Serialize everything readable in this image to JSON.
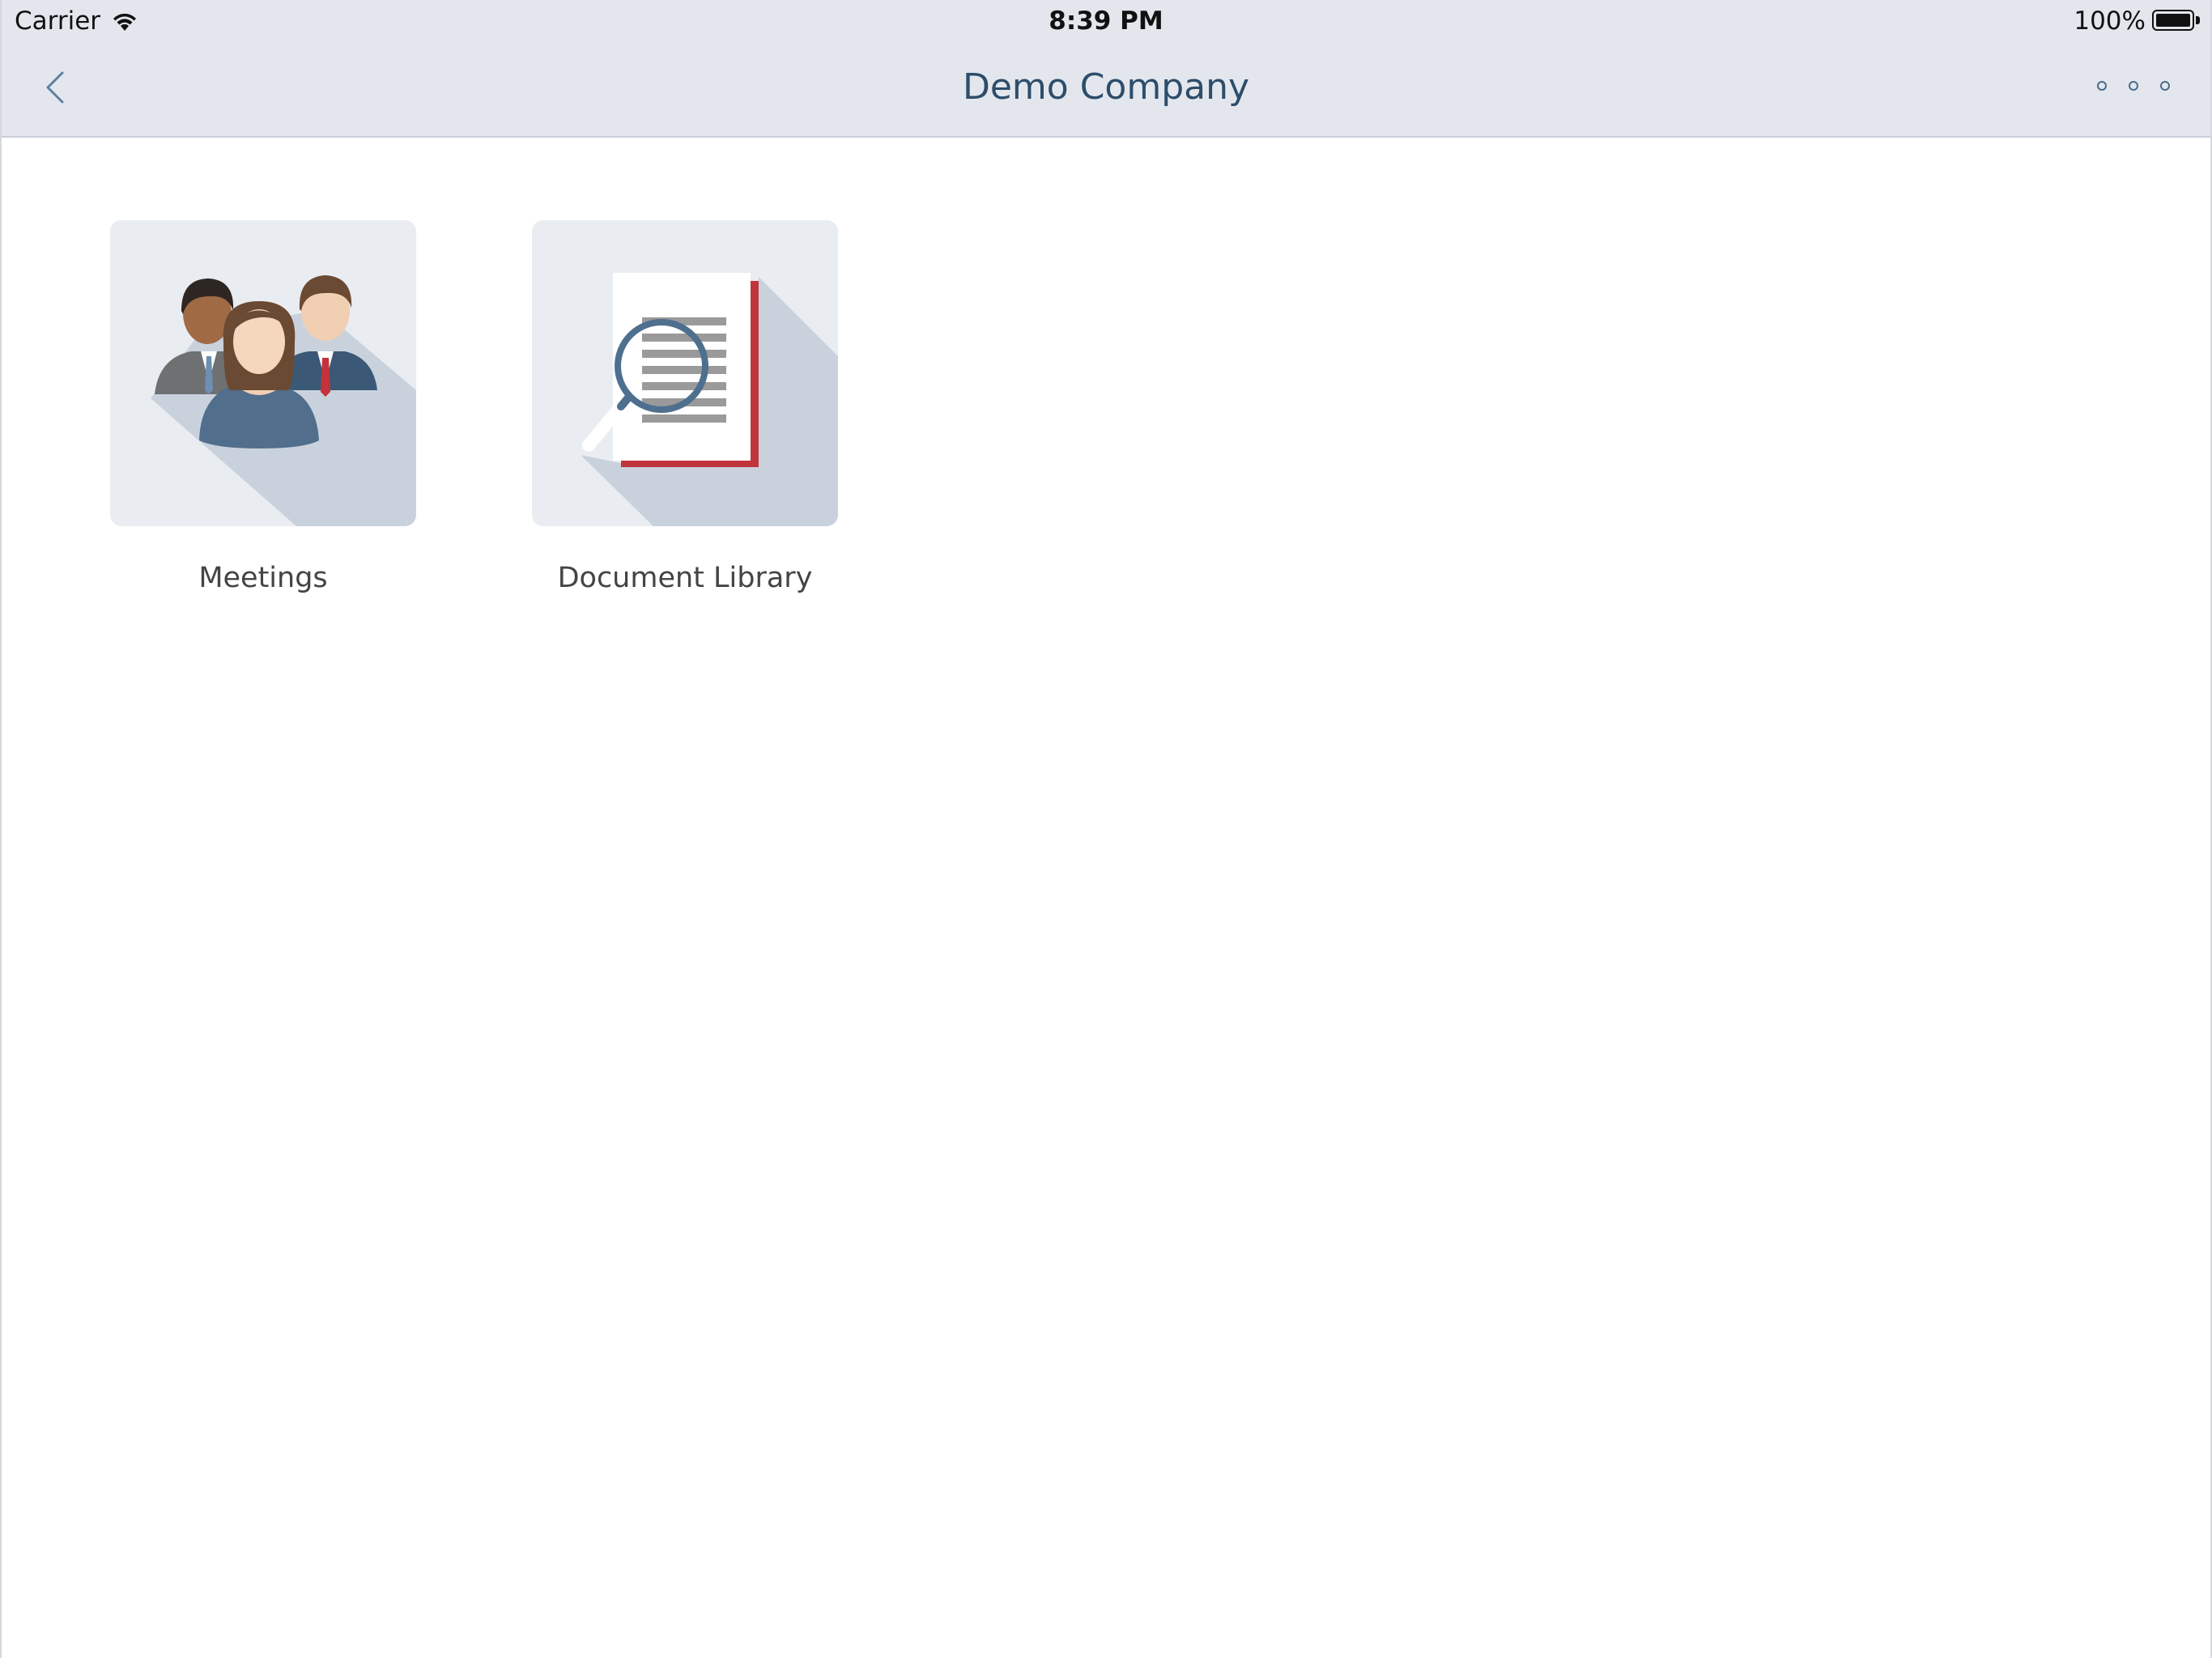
{
  "status_bar": {
    "carrier": "Carrier",
    "time": "8:39 PM",
    "battery": "100%"
  },
  "nav": {
    "title": "Demo Company",
    "back_icon": "chevron-left-icon",
    "more_icon": "more-dots-icon"
  },
  "tiles": [
    {
      "label": "Meetings",
      "icon": "people-group-icon"
    },
    {
      "label": "Document Library",
      "icon": "document-search-icon"
    }
  ],
  "colors": {
    "nav_background": "#e3e7ed",
    "title_color": "#2d4d6b",
    "tile_background": "#e9edf2",
    "tile_shadow": "#c8d1dc",
    "document_accent": "#c0343c"
  }
}
